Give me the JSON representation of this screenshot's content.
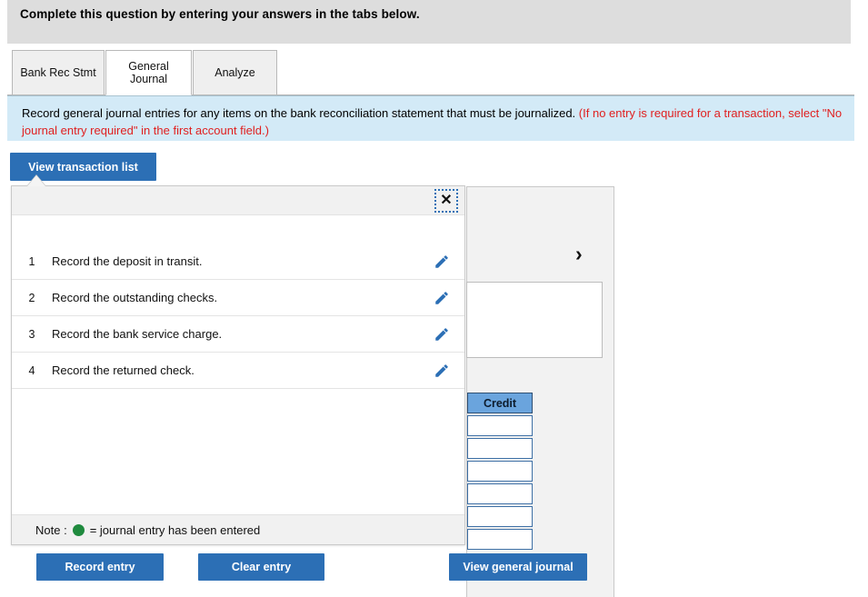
{
  "instruction_banner": {
    "text": "Complete this question by entering your answers in the tabs below."
  },
  "tabs": [
    {
      "id": "bank-rec-stmt",
      "label": "Bank Rec Stmt",
      "active": false
    },
    {
      "id": "general-journal",
      "label": "General Journal",
      "active": true
    },
    {
      "id": "analyze",
      "label": "Analyze",
      "active": false
    }
  ],
  "info_bar": {
    "black_text": "Record general journal entries for any items on the bank reconciliation statement that must be journalized.",
    "red_text": "(If no entry is required for a transaction, select \"No journal entry required\" in the first account field.)"
  },
  "toolbar": {
    "view_transaction_list_label": "View transaction list"
  },
  "transaction_popup": {
    "close_icon": "close-icon",
    "close_label": "✕",
    "rows": [
      {
        "num": "1",
        "label": "Record the deposit in transit.",
        "edit_icon": "pencil-icon"
      },
      {
        "num": "2",
        "label": "Record the outstanding checks.",
        "edit_icon": "pencil-icon"
      },
      {
        "num": "3",
        "label": "Record the bank service charge.",
        "edit_icon": "pencil-icon"
      },
      {
        "num": "4",
        "label": "Record the returned check.",
        "edit_icon": "pencil-icon"
      }
    ],
    "note_prefix": "Note :",
    "note_suffix": "= journal entry has been entered",
    "note_dot_icon": "green-dot-icon"
  },
  "journal_panel": {
    "chevron_icon": "chevron-right-icon",
    "chevron_glyph": "›",
    "credit_header": "Credit",
    "credit_cells": [
      "",
      "",
      "",
      "",
      "",
      ""
    ]
  },
  "actions": {
    "record_entry_label": "Record entry",
    "clear_entry_label": "Clear entry",
    "view_general_journal_label": "View general journal"
  },
  "colors": {
    "primary_blue": "#2c6fb5",
    "info_bar_bg": "#d3eaf7",
    "banner_bg": "#dddddd",
    "red_text": "#e02020",
    "green_dot": "#1f8a3e",
    "credit_header_bg": "#6aa4dd"
  }
}
